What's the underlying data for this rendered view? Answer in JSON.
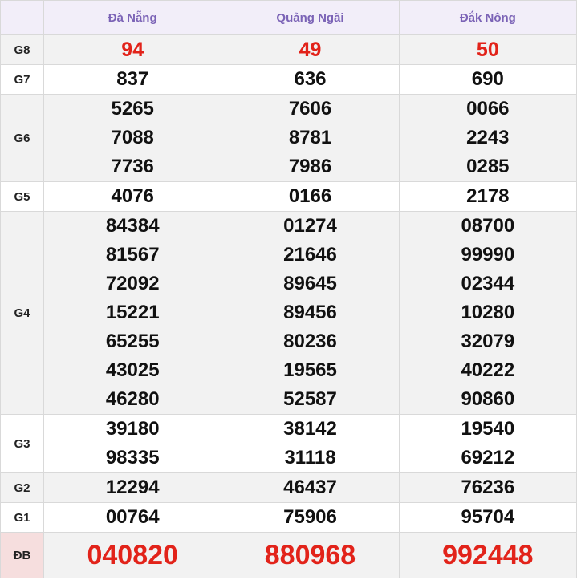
{
  "headers": [
    "",
    "Đà Nẵng",
    "Quảng Ngãi",
    "Đắk Nông"
  ],
  "rows": [
    {
      "label": "G8",
      "cols": [
        [
          "94"
        ],
        [
          "49"
        ],
        [
          "50"
        ]
      ]
    },
    {
      "label": "G7",
      "cols": [
        [
          "837"
        ],
        [
          "636"
        ],
        [
          "690"
        ]
      ]
    },
    {
      "label": "G6",
      "cols": [
        [
          "5265",
          "7088",
          "7736"
        ],
        [
          "7606",
          "8781",
          "7986"
        ],
        [
          "0066",
          "2243",
          "0285"
        ]
      ]
    },
    {
      "label": "G5",
      "cols": [
        [
          "4076"
        ],
        [
          "0166"
        ],
        [
          "2178"
        ]
      ]
    },
    {
      "label": "G4",
      "cols": [
        [
          "84384",
          "81567",
          "72092",
          "15221",
          "65255",
          "43025",
          "46280"
        ],
        [
          "01274",
          "21646",
          "89645",
          "89456",
          "80236",
          "19565",
          "52587"
        ],
        [
          "08700",
          "99990",
          "02344",
          "10280",
          "32079",
          "40222",
          "90860"
        ]
      ]
    },
    {
      "label": "G3",
      "cols": [
        [
          "39180",
          "98335"
        ],
        [
          "38142",
          "31118"
        ],
        [
          "19540",
          "69212"
        ]
      ]
    },
    {
      "label": "G2",
      "cols": [
        [
          "12294"
        ],
        [
          "46437"
        ],
        [
          "76236"
        ]
      ]
    },
    {
      "label": "G1",
      "cols": [
        [
          "00764"
        ],
        [
          "75906"
        ],
        [
          "95704"
        ]
      ]
    },
    {
      "label": "ĐB",
      "cols": [
        [
          "040820"
        ],
        [
          "880968"
        ],
        [
          "992448"
        ]
      ]
    }
  ],
  "colors": {
    "header_text": "#7b63b6",
    "highlight": "#e2231a"
  }
}
